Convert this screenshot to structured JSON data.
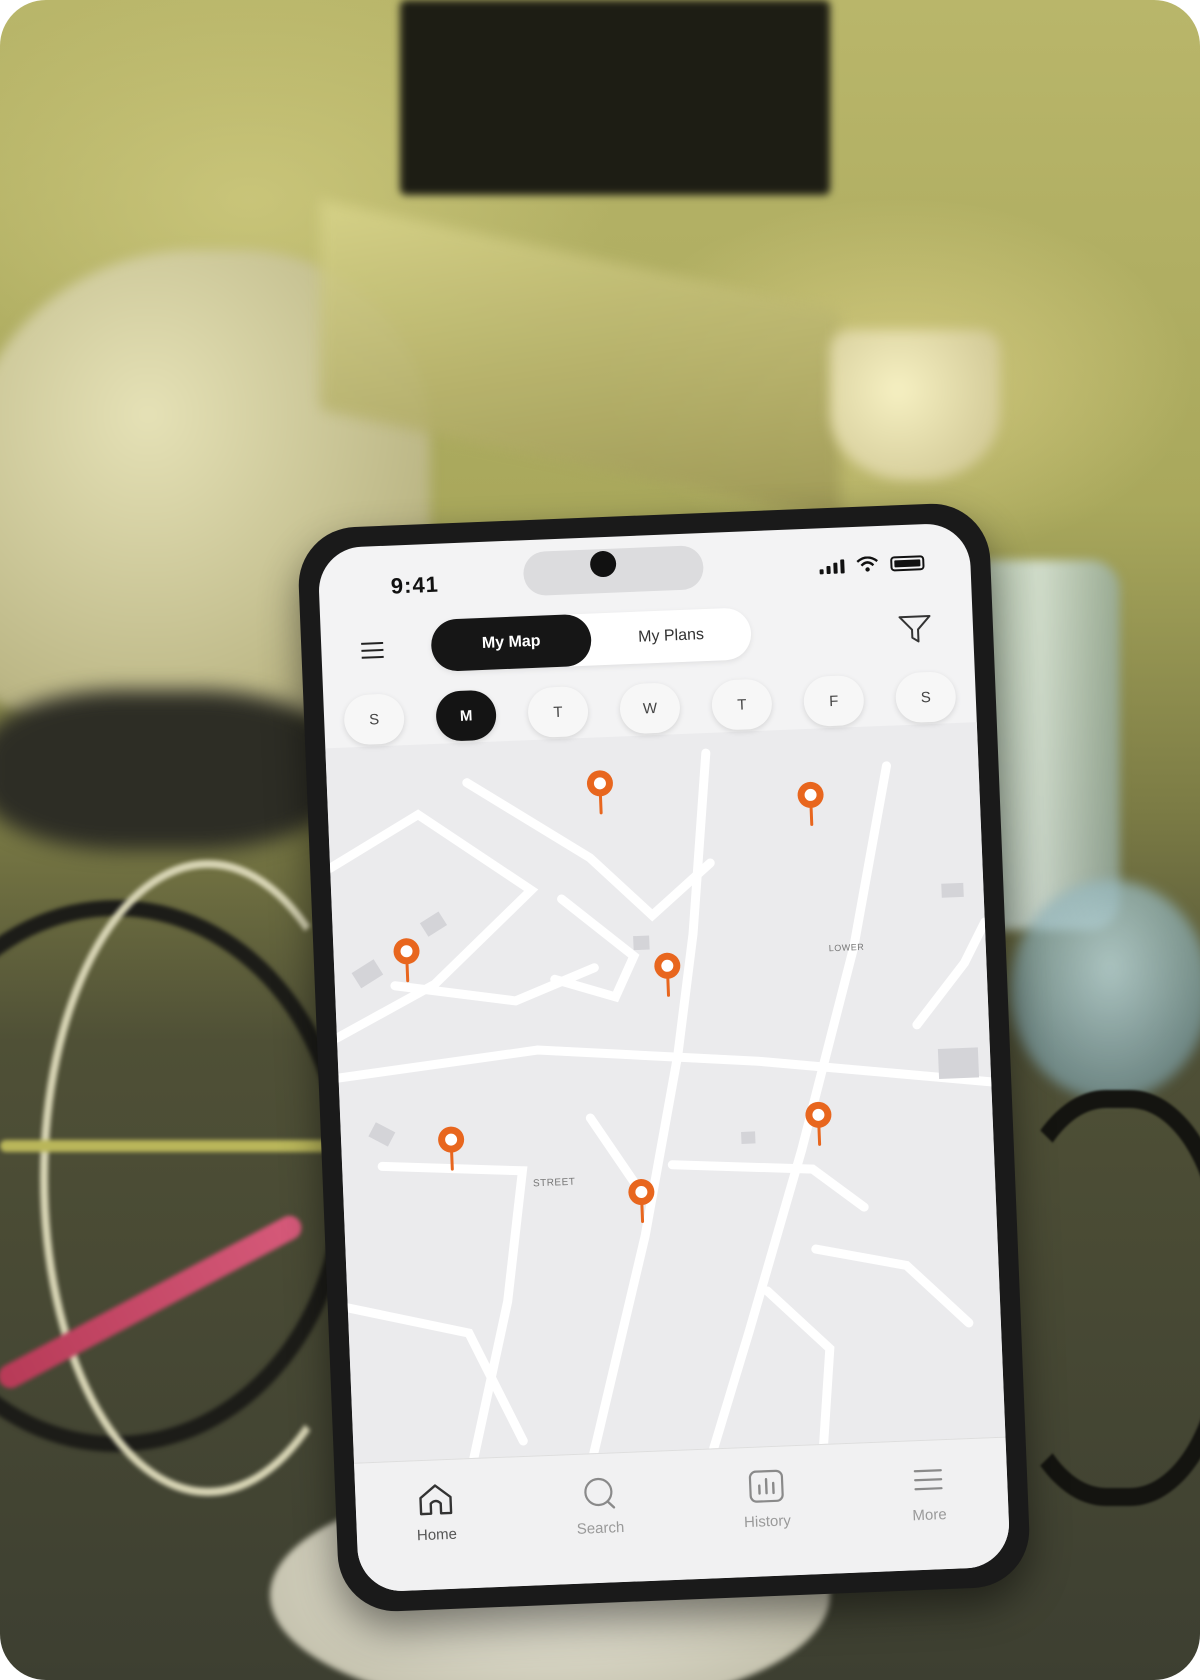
{
  "status_bar": {
    "time": "9:41"
  },
  "header": {
    "segment": [
      {
        "label": "My Map",
        "active": true
      },
      {
        "label": "My Plans",
        "active": false
      }
    ]
  },
  "days": [
    {
      "label": "S",
      "active": false
    },
    {
      "label": "M",
      "active": true
    },
    {
      "label": "T",
      "active": false
    },
    {
      "label": "W",
      "active": false
    },
    {
      "label": "T",
      "active": false
    },
    {
      "label": "F",
      "active": false
    },
    {
      "label": "S",
      "active": false
    }
  ],
  "map": {
    "street_labels": [
      "STREET",
      "LOWER"
    ],
    "pin_color": "#E8661E"
  },
  "tab_bar": [
    {
      "label": "Home",
      "icon": "home-icon",
      "active": true
    },
    {
      "label": "Search",
      "icon": "search-icon",
      "active": false
    },
    {
      "label": "History",
      "icon": "history-chart-icon",
      "active": false
    },
    {
      "label": "More",
      "icon": "more-menu-icon",
      "active": false
    }
  ],
  "colors": {
    "accent": "#E8661E",
    "active_pill": "#161616"
  }
}
